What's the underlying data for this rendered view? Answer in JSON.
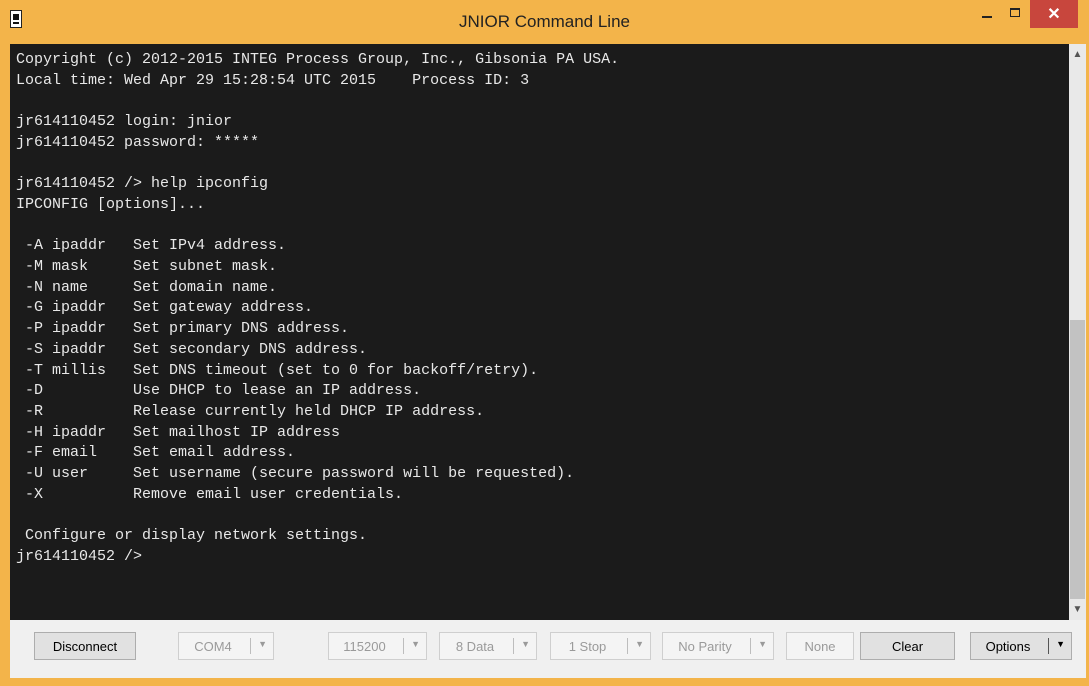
{
  "window": {
    "title": "JNIOR Command Line",
    "controls": {
      "minimize": "minimize",
      "maximize": "maximize",
      "close": "✕"
    },
    "accent": "#f3b44a",
    "close_color": "#c8463d"
  },
  "terminal": {
    "background": "#1b1b1b",
    "text_color": "#e8e8e8",
    "output": "Copyright (c) 2012-2015 INTEG Process Group, Inc., Gibsonia PA USA.\nLocal time: Wed Apr 29 15:28:54 UTC 2015    Process ID: 3\n\njr614110452 login: jnior\njr614110452 password: *****\n\njr614110452 /> help ipconfig\nIPCONFIG [options]...\n\n -A ipaddr   Set IPv4 address.\n -M mask     Set subnet mask.\n -N name     Set domain name.\n -G ipaddr   Set gateway address.\n -P ipaddr   Set primary DNS address.\n -S ipaddr   Set secondary DNS address.\n -T millis   Set DNS timeout (set to 0 for backoff/retry).\n -D          Use DHCP to lease an IP address.\n -R          Release currently held DHCP IP address.\n -H ipaddr   Set mailhost IP address\n -F email    Set email address.\n -U user     Set username (secure password will be requested).\n -X          Remove email user credentials.\n\n Configure or display network settings.\njr614110452 />"
  },
  "scrollbar": {
    "up_icon": "▲",
    "down_icon": "▼"
  },
  "toolbar": {
    "disconnect": "Disconnect",
    "port": "COM4",
    "baud": "115200",
    "data_bits": "8 Data",
    "stop_bits": "1 Stop",
    "parity": "No Parity",
    "flow": "None",
    "clear": "Clear",
    "options": "Options",
    "dropdown_icon": "▼"
  }
}
